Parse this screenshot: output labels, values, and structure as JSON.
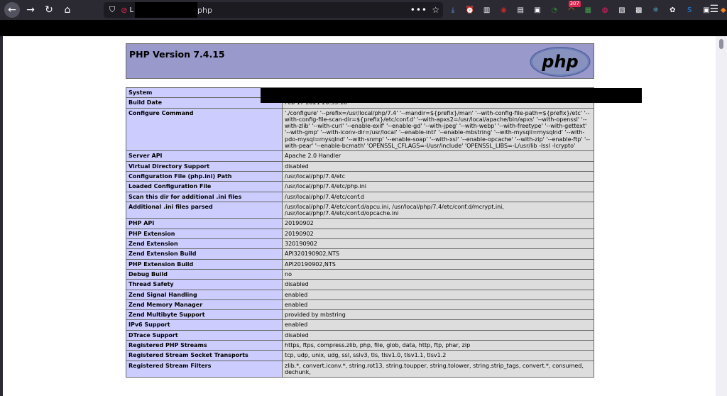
{
  "browser": {
    "url_prefix": "L",
    "url_suffix": "php",
    "more_label": "•••",
    "extensions": [
      {
        "name": "download-icon",
        "glyph": "⤓",
        "color": "#5fa3ff"
      },
      {
        "name": "alarm-icon",
        "glyph": "⏰",
        "color": "#fbfbfe"
      },
      {
        "name": "library-icon",
        "glyph": "▥",
        "color": "#fbfbfe"
      },
      {
        "name": "ublock-icon",
        "glyph": "◉",
        "color": "#c62828"
      },
      {
        "name": "document-icon",
        "glyph": "▤",
        "color": "#fbfbfe"
      },
      {
        "name": "image-icon",
        "glyph": "▣",
        "color": "#fbfbfe"
      },
      {
        "name": "timer-icon",
        "glyph": "◔",
        "color": "#2e7d32"
      },
      {
        "name": "rss-icon",
        "glyph": "◠",
        "color": "#f57c00",
        "badge": "307"
      },
      {
        "name": "feed-icon",
        "glyph": "▦",
        "color": "#43a047"
      },
      {
        "name": "screen-icon",
        "glyph": "◍",
        "color": "#e91e63"
      },
      {
        "name": "bookmark-icon",
        "glyph": "▧",
        "color": "#fbfbfe"
      },
      {
        "name": "grid-icon",
        "glyph": "▩",
        "color": "#fbfbfe"
      },
      {
        "name": "react-icon",
        "glyph": "⚛",
        "color": "#61dafb"
      },
      {
        "name": "gear-icon",
        "glyph": "✿",
        "color": "#fbfbfe"
      },
      {
        "name": "s-icon",
        "glyph": "S",
        "color": "#1e88e5"
      },
      {
        "name": "briefcase-icon",
        "glyph": "▣",
        "color": "#fbfbfe"
      },
      {
        "name": "metamask-icon",
        "glyph": "◆",
        "color": "#f6851b"
      }
    ]
  },
  "phpinfo": {
    "title": "PHP Version 7.4.15",
    "rows": [
      {
        "label": "System",
        "value": ""
      },
      {
        "label": "Build Date",
        "value": "Feb 17 2021 20:35:18"
      },
      {
        "label": "Configure Command",
        "value": "'./configure' '--prefix=/usr/local/php/7.4' '--mandir=${prefix}/man' '--with-config-file-path=${prefix}/etc' '--with-config-file-scan-dir=${prefix}/etc/conf.d' '--with-apxs2=/usr/local/apache/bin/apxs' '--with-openssl' '--with-zlib' '--with-curl' '--enable-exif' '--enable-gd' '--with-jpeg' '--with-webp' '--with-freetype' '--with-gettext' '--with-gmp' '--with-iconv-dir=/usr/local' '--enable-intl' '--enable-mbstring' '--with-mysqli=mysqlnd' '--with-pdo-mysql=mysqlnd' '--with-snmp' '--enable-soap' '--with-xsl' '--enable-opcache' '--with-zip' '--enable-ftp' '--with-pear' '--enable-bcmath' 'OPENSSL_CFLAGS=-I/usr/include' 'OPENSSL_LIBS=-L/usr/lib -lssl -lcrypto'"
      },
      {
        "label": "Server API",
        "value": "Apache 2.0 Handler"
      },
      {
        "label": "Virtual Directory Support",
        "value": "disabled"
      },
      {
        "label": "Configuration File (php.ini) Path",
        "value": "/usr/local/php/7.4/etc"
      },
      {
        "label": "Loaded Configuration File",
        "value": "/usr/local/php/7.4/etc/php.ini"
      },
      {
        "label": "Scan this dir for additional .ini files",
        "value": "/usr/local/php/7.4/etc/conf.d"
      },
      {
        "label": "Additional .ini files parsed",
        "value": "/usr/local/php/7.4/etc/conf.d/apcu.ini, /usr/local/php/7.4/etc/conf.d/mcrypt.ini, /usr/local/php/7.4/etc/conf.d/opcache.ini"
      },
      {
        "label": "PHP API",
        "value": "20190902"
      },
      {
        "label": "PHP Extension",
        "value": "20190902"
      },
      {
        "label": "Zend Extension",
        "value": "320190902"
      },
      {
        "label": "Zend Extension Build",
        "value": "API320190902,NTS"
      },
      {
        "label": "PHP Extension Build",
        "value": "API20190902,NTS"
      },
      {
        "label": "Debug Build",
        "value": "no"
      },
      {
        "label": "Thread Safety",
        "value": "disabled"
      },
      {
        "label": "Zend Signal Handling",
        "value": "enabled"
      },
      {
        "label": "Zend Memory Manager",
        "value": "enabled"
      },
      {
        "label": "Zend Multibyte Support",
        "value": "provided by mbstring"
      },
      {
        "label": "IPv6 Support",
        "value": "enabled"
      },
      {
        "label": "DTrace Support",
        "value": "disabled"
      },
      {
        "label": "Registered PHP Streams",
        "value": "https, ftps, compress.zlib, php, file, glob, data, http, ftp, phar, zip"
      },
      {
        "label": "Registered Stream Socket Transports",
        "value": "tcp, udp, unix, udg, ssl, sslv3, tls, tlsv1.0, tlsv1.1, tlsv1.2"
      },
      {
        "label": "Registered Stream Filters",
        "value": "zlib.*, convert.iconv.*, string.rot13, string.toupper, string.tolower, string.strip_tags, convert.*, consumed, dechunk,"
      }
    ]
  }
}
